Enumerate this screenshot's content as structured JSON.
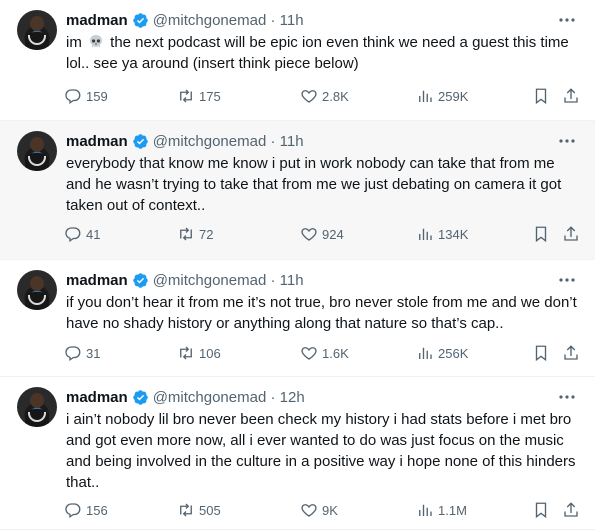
{
  "tweets": [
    {
      "name": "madman",
      "handle": "@mitchgonemad · 11h",
      "text_before": "im ",
      "text_after": " the next podcast will be epic ion even think we need a guest this time lol.. see ya around (insert think piece below)",
      "replies": "159",
      "retweets": "175",
      "likes": "2.8K",
      "views": "259K"
    },
    {
      "name": "madman",
      "handle": "@mitchgonemad · 11h",
      "text": "everybody that know me know i put in work nobody can take that from me and he wasn’t trying to take that from me we just debating on camera it got taken out of context..",
      "replies": "41",
      "retweets": "72",
      "likes": "924",
      "views": "134K"
    },
    {
      "name": "madman",
      "handle": "@mitchgonemad · 11h",
      "text": "if you don’t hear it from me it’s not true, bro never stole from me and we don’t have no shady history or anything along that nature so that’s cap..",
      "replies": "31",
      "retweets": "106",
      "likes": "1.6K",
      "views": "256K"
    },
    {
      "name": "madman",
      "handle": "@mitchgonemad · 12h",
      "text": "i ain’t nobody lil bro never been check my history i had stats before i met bro and got even more now, all i ever wanted to do was just focus on the music and being involved in the culture in a positive way i hope none of this hinders that..",
      "replies": "156",
      "retweets": "505",
      "likes": "9K",
      "views": "1.1M"
    }
  ],
  "icons": {
    "verified": "verified-badge-icon",
    "skull": "skull-emoji-icon",
    "reply": "reply-icon",
    "retweet": "retweet-icon",
    "like": "heart-icon",
    "views": "views-chart-icon",
    "bookmark": "bookmark-icon",
    "share": "share-icon",
    "more": "more-options-icon"
  },
  "colors": {
    "text": "#0f1419",
    "secondary": "#536471",
    "verified": "#1d9bf0",
    "highlight_background": "#f7f7f7",
    "divider": "#eff3f4"
  }
}
